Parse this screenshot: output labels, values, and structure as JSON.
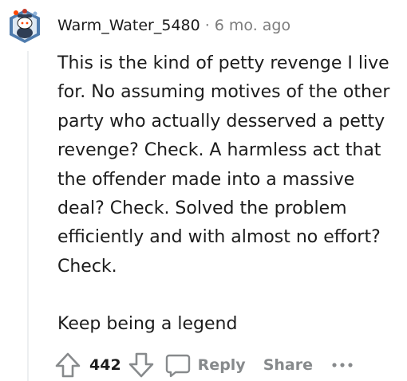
{
  "comment": {
    "author": "Warm_Water_5480",
    "separator": "·",
    "timestamp": "6 mo. ago",
    "paragraphs": [
      "This is the kind of petty revenge I live for. No assuming motives of the other party who actually desserved a petty revenge? Check. A harmless act that the offender made into a massive deal? Check. Solved the problem efficiently and with almost no effort? Check.",
      "Keep being a legend"
    ],
    "score": "442",
    "actions": {
      "reply_label": "Reply",
      "share_label": "Share"
    },
    "icons": {
      "avatar": "snoo-avatar-icon",
      "upvote": "upvote-arrow-icon",
      "downvote": "downvote-arrow-icon",
      "reply": "speech-bubble-icon",
      "more": "ellipsis-icon"
    },
    "colors": {
      "text": "#1c1c1c",
      "meta": "#7c7c7c",
      "action": "#878a8c",
      "thread_line": "#edeff1"
    }
  }
}
